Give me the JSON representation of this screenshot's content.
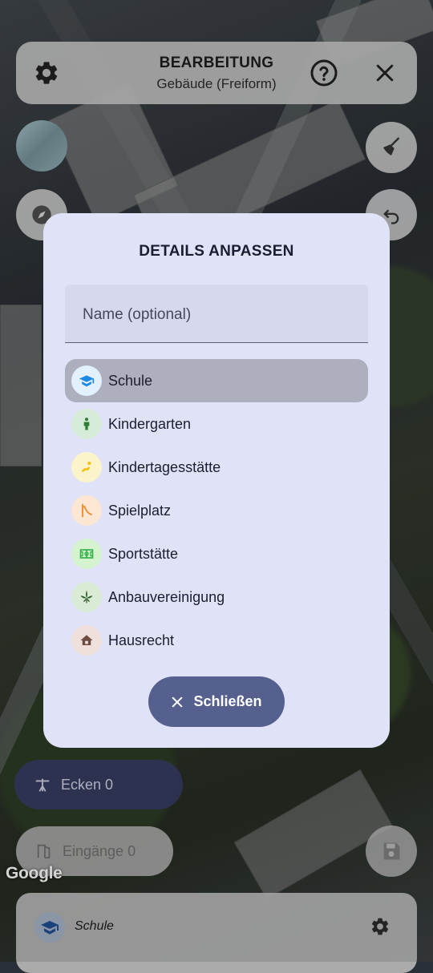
{
  "header": {
    "title": "BEARBEITUNG",
    "subtitle": "Gebäude (Freiform)"
  },
  "dialog": {
    "title": "DETAILS ANPASSEN",
    "name_placeholder": "Name (optional)",
    "items": [
      {
        "label": "Schule",
        "icon": "school-icon",
        "selected": true
      },
      {
        "label": "Kindergarten",
        "icon": "child-icon",
        "selected": false
      },
      {
        "label": "Kindertagesstätte",
        "icon": "baby-crawl-icon",
        "selected": false
      },
      {
        "label": "Spielplatz",
        "icon": "slide-icon",
        "selected": false
      },
      {
        "label": "Sportstätte",
        "icon": "stadium-icon",
        "selected": false
      },
      {
        "label": "Anbauvereinigung",
        "icon": "cannabis-leaf-icon",
        "selected": false
      },
      {
        "label": "Hausrecht",
        "icon": "house-icon",
        "selected": false
      }
    ],
    "close_label": "Schließen"
  },
  "chips": {
    "ecken": "Ecken 0",
    "eingaenge": "Eingänge 0"
  },
  "map": {
    "attribution": "Google"
  },
  "bottom_panel": {
    "label": "Schule"
  },
  "colors": {
    "dialog_bg": "#e0e2f8",
    "selected_item": "#adafbf",
    "close_button": "#56608f",
    "school_icon": "#1e88e5",
    "kindergarten_icon": "#2e7d32",
    "kita_icon": "#f9c80e",
    "spielplatz_icon": "#ef8a2c",
    "sport_icon": "#33b24a",
    "anbau_icon": "#2e5d2a",
    "hausrecht_icon": "#6d4c41"
  }
}
